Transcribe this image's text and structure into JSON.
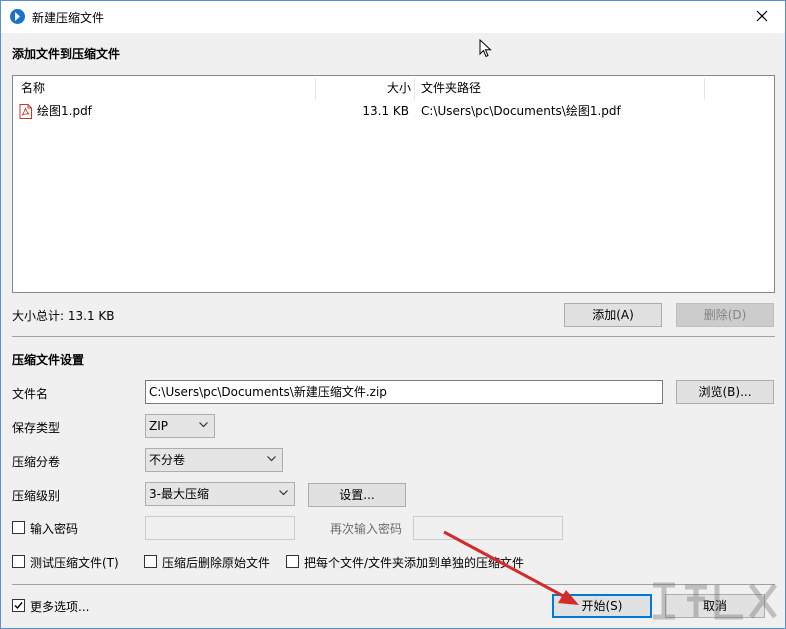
{
  "window": {
    "title": "新建压缩文件",
    "close_icon": "close-icon"
  },
  "add_section": {
    "title": "添加文件到压缩文件"
  },
  "file_list": {
    "columns": {
      "name": "名称",
      "size": "大小",
      "path": "文件夹路径"
    },
    "rows": [
      {
        "icon": "pdf-file-icon",
        "name": "绘图1.pdf",
        "size": "13.1 KB",
        "path": "C:\\Users\\pc\\Documents\\绘图1.pdf"
      }
    ]
  },
  "total_size": "大小总计: 13.1 KB",
  "buttons": {
    "add": "添加(A)",
    "delete": "删除(D)",
    "browse": "浏览(B)...",
    "settings": "设置...",
    "start": "开始(S)",
    "cancel": "取消"
  },
  "settings_section": {
    "title": "压缩文件设置",
    "filename_label": "文件名",
    "filename_value": "C:\\Users\\pc\\Documents\\新建压缩文件.zip",
    "save_type_label": "保存类型",
    "save_type_value": "ZIP",
    "split_label": "压缩分卷",
    "split_value": "不分卷",
    "level_label": "压缩级别",
    "level_value": "3-最大压缩",
    "password_label": "输入密码",
    "password_value": "",
    "password_checked": false,
    "repeat_password_label": "再次输入密码",
    "repeat_password_value": ""
  },
  "options": {
    "test_archive": {
      "label": "测试压缩文件(T)",
      "checked": false
    },
    "delete_after": {
      "label": "压缩后删除原始文件",
      "checked": false
    },
    "each_separate": {
      "label": "把每个文件/文件夹添加到单独的压缩文件",
      "checked": false
    }
  },
  "more_options": {
    "label": "更多选项...",
    "checked": true
  },
  "colors": {
    "arrow": "#d42a2a",
    "accent": "#0078d7"
  }
}
